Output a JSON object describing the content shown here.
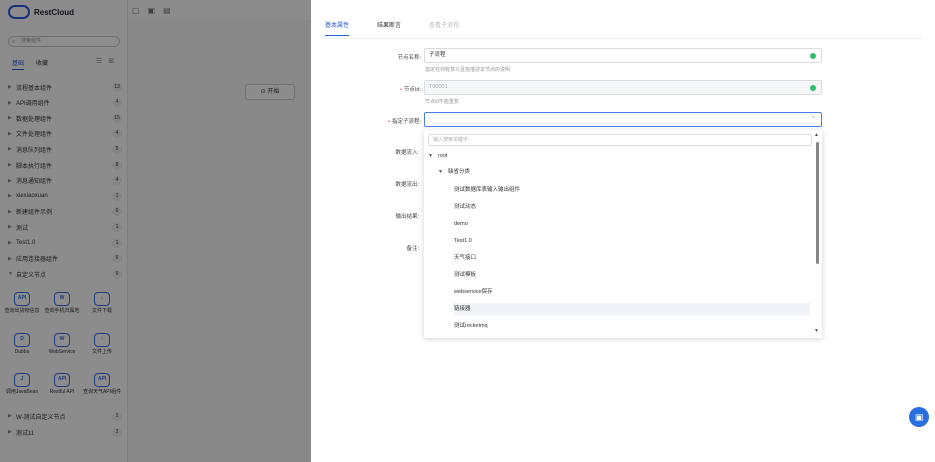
{
  "app": {
    "brand": "RestCloud"
  },
  "sidebar": {
    "search_placeholder": "搜索组件",
    "tabs": [
      "基础",
      "收藏"
    ],
    "categories": [
      {
        "label": "流程基本组件",
        "count": "13"
      },
      {
        "label": "API调用组件",
        "count": "4"
      },
      {
        "label": "数据处理组件",
        "count": "15"
      },
      {
        "label": "文件处理组件",
        "count": "4"
      },
      {
        "label": "消息队列组件",
        "count": "5"
      },
      {
        "label": "脚本执行组件",
        "count": "8"
      },
      {
        "label": "消息通知组件",
        "count": "4"
      },
      {
        "label": "xiexiaoxuan",
        "count": "1"
      },
      {
        "label": "新建组件示例",
        "count": "0"
      },
      {
        "label": "测试",
        "count": "1"
      },
      {
        "label": "Test1.0",
        "count": "1"
      },
      {
        "label": "应用连接器组件",
        "count": "6"
      },
      {
        "label": "自定义节点",
        "count": "9"
      }
    ],
    "custom_nodes": [
      {
        "label": "查询出货物信息",
        "icon": "API"
      },
      {
        "label": "查询手机归属地",
        "icon": "W"
      },
      {
        "label": "文件下载",
        "icon": "↓"
      },
      {
        "label": "Dubbo",
        "icon": "D"
      },
      {
        "label": "WebService",
        "icon": "W"
      },
      {
        "label": "文件上传",
        "icon": "↑"
      },
      {
        "label": "调用JavaBean",
        "icon": "J"
      },
      {
        "label": "Restful API",
        "icon": "API"
      },
      {
        "label": "查询天气API组件",
        "icon": "API"
      }
    ],
    "bottom_categories": [
      {
        "label": "W-测试自定义节点",
        "count": "1"
      },
      {
        "label": "测试11",
        "count": "2"
      }
    ]
  },
  "canvas": {
    "start_label": "开始"
  },
  "drawer": {
    "tabs": [
      "基本属性",
      "结果断言",
      "查看子流程"
    ],
    "fields": {
      "node_name": {
        "label": "节点名称:",
        "value": "子流程",
        "help": "指定任何有意义且能描述本节点的说明"
      },
      "node_id": {
        "label": "节点Id:",
        "value": "T00001",
        "help": "节点id不能重复"
      },
      "sub_process": {
        "label": "指定子流程:",
        "value": ""
      },
      "data_in": {
        "label": "数据流入:"
      },
      "data_out": {
        "label": "数据流出:"
      },
      "output": {
        "label": "输出结果:"
      },
      "remark": {
        "label": "备注:"
      }
    },
    "dropdown": {
      "search_placeholder": "输入搜索关键字",
      "root": "root",
      "group": "缺省分类",
      "items": [
        "测试数据库表输入输出组件",
        "测试动态",
        "demo",
        "Test1.0",
        "天气接口",
        "测试模板",
        "webservice保存",
        "链接器",
        "测试rocketmq"
      ]
    }
  },
  "colors": {
    "accent": "#2a5bd7",
    "success": "#2fbf6c",
    "required": "#e5484d"
  }
}
